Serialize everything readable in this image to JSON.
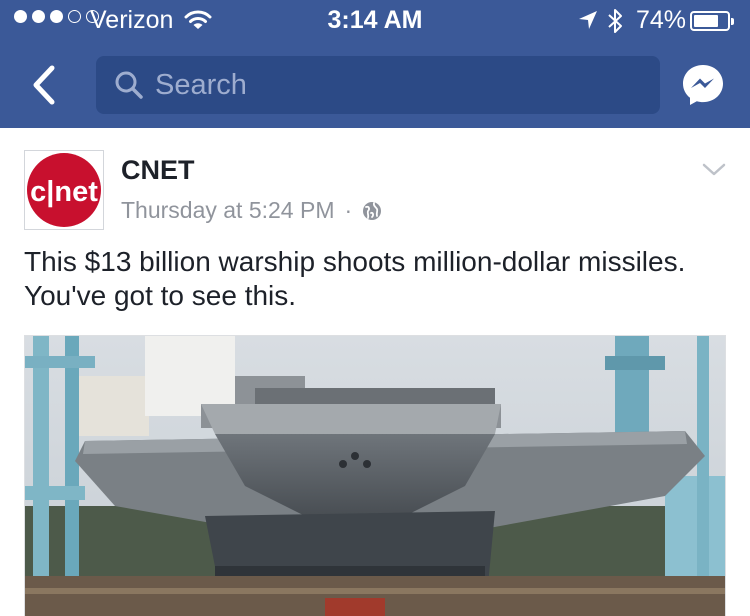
{
  "status_bar": {
    "carrier": "Verizon",
    "time": "3:14 AM",
    "battery_percent_text": "74%",
    "battery_level": 0.74,
    "signal_bars_filled": 3,
    "signal_bars_total": 5
  },
  "nav": {
    "search_placeholder": "Search",
    "back_icon": "chevron-left-icon",
    "messenger_icon": "messenger-icon"
  },
  "post": {
    "page_name": "CNET",
    "avatar_logo_text": "c|net",
    "timestamp": "Thursday at 5:24 PM",
    "separator": "·",
    "privacy_icon": "globe-icon",
    "text": "This $13 billion warship shoots million-dollar missiles. You've got to see this.",
    "photo_subject": "aircraft-carrier-photo"
  },
  "colors": {
    "nav_bar": "#3b5998",
    "search_box": "#2c4a86",
    "cnet_red": "#c8102e",
    "feed_bg": "#e9ebee"
  }
}
